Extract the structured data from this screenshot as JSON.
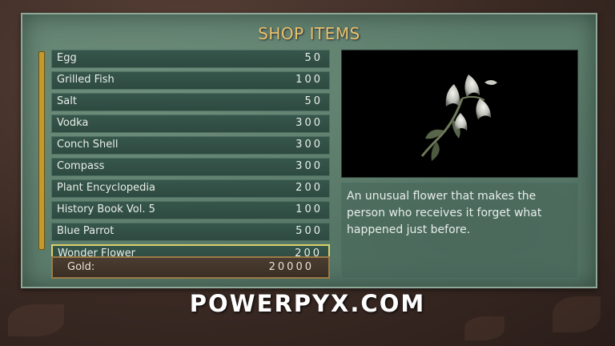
{
  "shop": {
    "title": "SHOP ITEMS",
    "items": [
      {
        "name": "Egg",
        "price": "50"
      },
      {
        "name": "Grilled Fish",
        "price": "100"
      },
      {
        "name": "Salt",
        "price": "50"
      },
      {
        "name": "Vodka",
        "price": "300"
      },
      {
        "name": "Conch Shell",
        "price": "300"
      },
      {
        "name": "Compass",
        "price": "300"
      },
      {
        "name": "Plant Encyclopedia",
        "price": "200"
      },
      {
        "name": "History Book Vol. 5",
        "price": "100"
      },
      {
        "name": "Blue Parrot",
        "price": "500"
      },
      {
        "name": "Wonder Flower",
        "price": "200"
      }
    ],
    "selected_index": 9,
    "gold_label": "Gold:",
    "gold_value": "20000"
  },
  "detail": {
    "preview_icon": "white-lily-flower",
    "description": "An unusual flower that makes the person who receives it forget what happened just before."
  },
  "watermark": "POWERPYX.COM",
  "colors": {
    "title": "#e9c169",
    "selection_border": "#d9d06a",
    "scrollbar": "#c59a2a"
  }
}
